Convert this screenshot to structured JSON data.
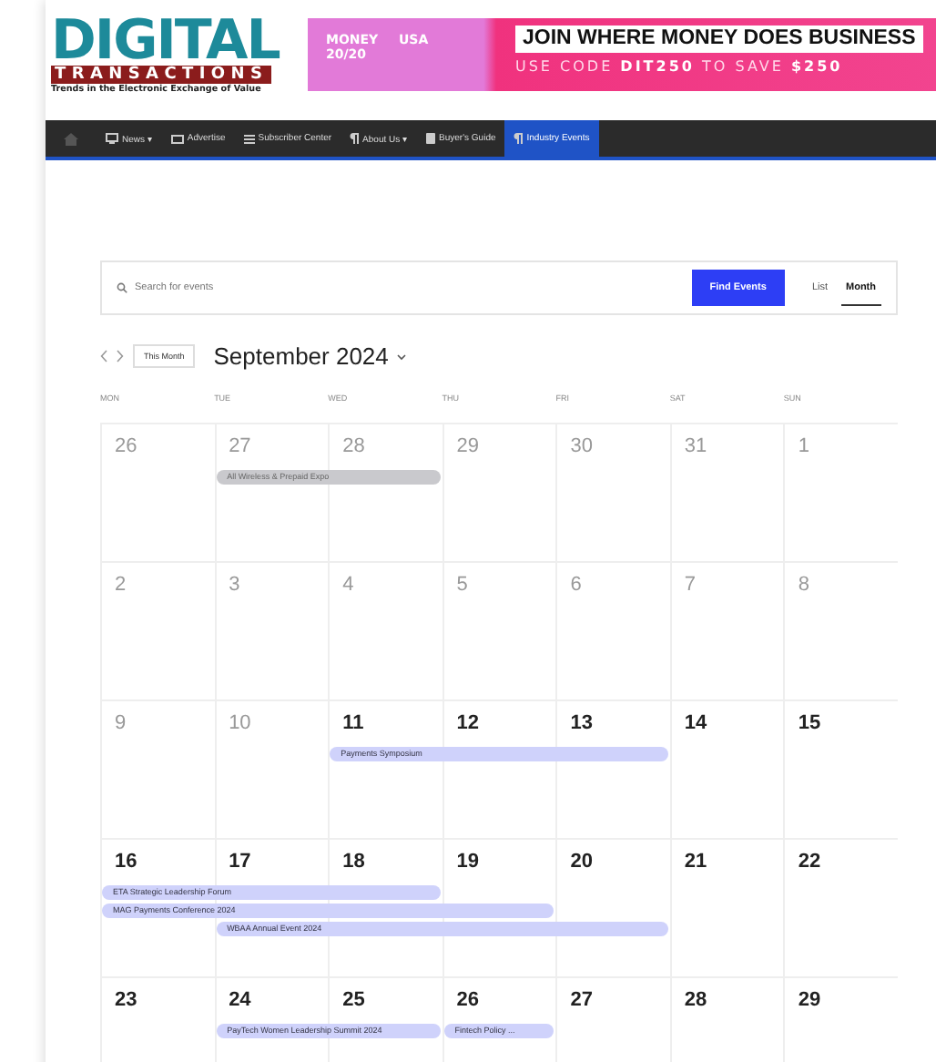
{
  "logo": {
    "title": "DIGITAL",
    "subtitle": "TRANSACTIONS",
    "tagline": "Trends in the Electronic Exchange of Value"
  },
  "banner": {
    "brand": "MONEY 20/20",
    "region": "USA",
    "headline": "JOIN WHERE MONEY DOES BUSINESS",
    "promo": "USE CODE **DIT250**  TO SAVE **$250**"
  },
  "nav": [
    {
      "label": "News ▾",
      "selected": false
    },
    {
      "label": "Advertise",
      "selected": false
    },
    {
      "label": "Subscriber Center",
      "selected": false
    },
    {
      "label": "About Us ▾",
      "selected": false
    },
    {
      "label": "Buyer's Guide",
      "selected": false
    },
    {
      "label": "Industry Events",
      "selected": true
    }
  ],
  "search": {
    "placeholder": "Search for events",
    "button": "Find Events",
    "views": [
      {
        "label": "List",
        "selected": false
      },
      {
        "label": "Month",
        "selected": true
      }
    ]
  },
  "month_nav": {
    "today": "This Month",
    "title": "September 2024"
  },
  "weekdays": [
    "MON",
    "TUE",
    "WED",
    "THU",
    "FRI",
    "SAT",
    "SUN"
  ],
  "weeks": [
    {
      "days": [
        {
          "date": "26",
          "past": true
        },
        {
          "date": "27",
          "past": true,
          "events": [
            {
              "kind": "start",
              "title": "All Wireless & Prepaid Expo",
              "past": true
            }
          ]
        },
        {
          "date": "28",
          "past": true,
          "events": [
            {
              "kind": "continue"
            }
          ]
        },
        {
          "date": "29",
          "past": true
        },
        {
          "date": "30",
          "past": true
        },
        {
          "date": "31",
          "past": true
        },
        {
          "date": "1",
          "past": true
        }
      ]
    },
    {
      "days": [
        {
          "date": "2",
          "past": true
        },
        {
          "date": "3",
          "past": true
        },
        {
          "date": "4",
          "past": true
        },
        {
          "date": "5",
          "past": true
        },
        {
          "date": "6",
          "past": true
        },
        {
          "date": "7",
          "past": true
        },
        {
          "date": "8",
          "past": true
        }
      ]
    },
    {
      "days": [
        {
          "date": "9",
          "past": true
        },
        {
          "date": "10",
          "past": true
        },
        {
          "date": "11",
          "past": false,
          "events": [
            {
              "kind": "start",
              "title": "Payments Symposium",
              "past": false
            }
          ]
        },
        {
          "date": "12",
          "past": false,
          "events": [
            {
              "kind": "continue"
            }
          ]
        },
        {
          "date": "13",
          "past": false,
          "events": [
            {
              "kind": "continue"
            }
          ]
        },
        {
          "date": "14",
          "past": false
        },
        {
          "date": "15",
          "past": false
        }
      ]
    },
    {
      "days": [
        {
          "date": "16",
          "past": false,
          "events": [
            {
              "kind": "start",
              "title": "ETA Strategic Leadership Forum",
              "past": false
            },
            {
              "kind": "start",
              "title": "MAG Payments Conference 2024",
              "past": false
            }
          ]
        },
        {
          "date": "17",
          "past": false,
          "events": [
            {
              "kind": "continue"
            },
            {
              "kind": "continue"
            },
            {
              "kind": "start",
              "title": "WBAA Annual Event 2024",
              "past": false
            }
          ]
        },
        {
          "date": "18",
          "past": false,
          "events": [
            {
              "kind": "continue"
            },
            {
              "kind": "continue"
            },
            {
              "kind": "continue"
            }
          ]
        },
        {
          "date": "19",
          "past": false,
          "events": [
            {
              "kind": "gap"
            },
            {
              "kind": "continue"
            },
            {
              "kind": "continue"
            }
          ]
        },
        {
          "date": "20",
          "past": false,
          "events": [
            {
              "kind": "gap"
            },
            {
              "kind": "gap"
            },
            {
              "kind": "continue"
            }
          ]
        },
        {
          "date": "21",
          "past": false
        },
        {
          "date": "22",
          "past": false
        }
      ]
    },
    {
      "days": [
        {
          "date": "23",
          "past": false
        },
        {
          "date": "24",
          "past": false,
          "events": [
            {
              "kind": "start",
              "title": "PayTech Women Leadership Summit 2024",
              "past": false
            }
          ]
        },
        {
          "date": "25",
          "past": false,
          "events": [
            {
              "kind": "continue"
            }
          ]
        },
        {
          "date": "26",
          "past": false,
          "events": [
            {
              "kind": "start",
              "title": "Fintech Policy ...",
              "past": false
            }
          ]
        },
        {
          "date": "27",
          "past": false
        },
        {
          "date": "28",
          "past": false
        },
        {
          "date": "29",
          "past": false
        }
      ]
    }
  ]
}
